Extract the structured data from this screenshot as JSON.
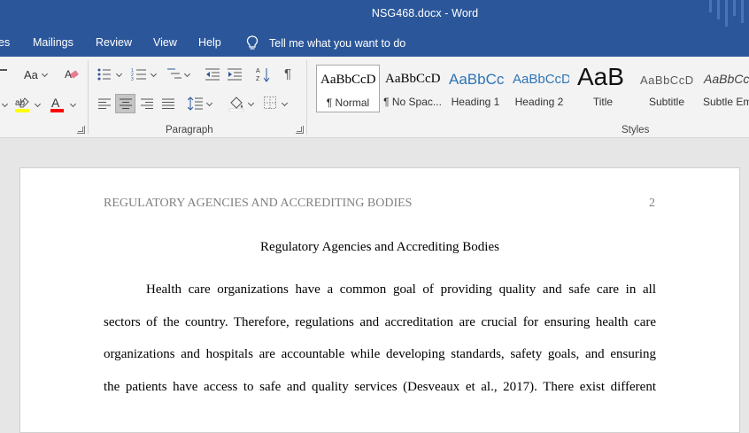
{
  "window": {
    "title": "NSG468.docx  -  Word"
  },
  "tabs": [
    "es",
    "Mailings",
    "Review",
    "View",
    "Help"
  ],
  "tell_me": "Tell me what you want to do",
  "ribbon": {
    "font_group": {
      "change_case": "Aa",
      "highlight_color": "#ffff00",
      "font_color": "#ff0000"
    },
    "paragraph_label": "Paragraph",
    "styles_label": "Styles",
    "styles": [
      {
        "preview": "AaBbCcD",
        "name": "¶ Normal"
      },
      {
        "preview": "AaBbCcD",
        "name": "¶ No Spac..."
      },
      {
        "preview": "AaBbCc",
        "name": "Heading 1"
      },
      {
        "preview": "AaBbCcD",
        "name": "Heading 2"
      },
      {
        "preview": "AaB",
        "name": "Title"
      },
      {
        "preview": "AaBbCcD",
        "name": "Subtitle"
      },
      {
        "preview": "AaBbCcI",
        "name": "Subtle Em"
      }
    ]
  },
  "document": {
    "running_head": "REGULATORY AGENCIES AND ACCREDITING BODIES",
    "page_number": "2",
    "title": "Regulatory Agencies and Accrediting Bodies",
    "lines": [
      "Health care organizations have a common goal of providing quality and safe care in all",
      "sectors of the country. Therefore, regulations and accreditation are crucial for ensuring health care",
      "organizations and hospitals are accountable while developing standards, safety goals, and ensuring",
      "the patients have access to safe and quality services (Desveaux et al., 2017). There exist different"
    ]
  },
  "colors": {
    "accent": "#2b579a",
    "ribbon_bg": "#f3f3f3",
    "heading_blue": "#2e74b5"
  }
}
